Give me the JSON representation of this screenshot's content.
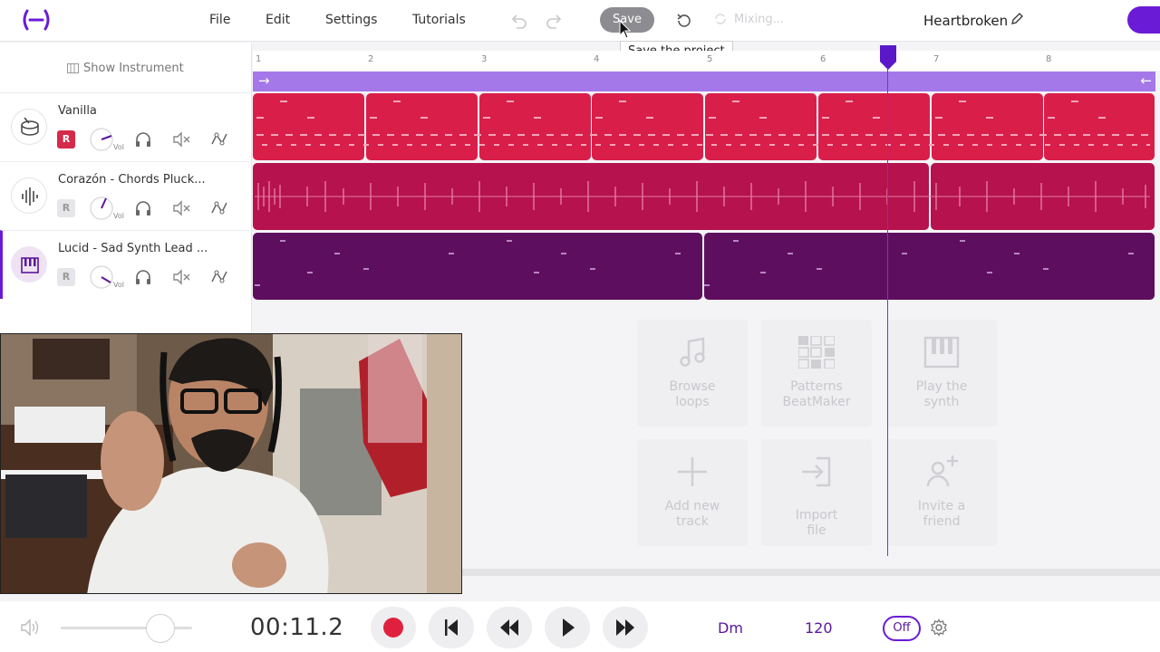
{
  "menu": {
    "file": "File",
    "edit": "Edit",
    "settings": "Settings",
    "tutorials": "Tutorials"
  },
  "toolbar": {
    "save_label": "Save",
    "save_tooltip": "Save the project",
    "mixing_label": "Mixing..."
  },
  "project": {
    "title": "Heartbroken"
  },
  "left_panel": {
    "show_instrument": "Show Instrument"
  },
  "tracks": [
    {
      "name": "Vanilla",
      "record": "R",
      "vol_label": "Vol",
      "icon": "drum-icon",
      "armed": true
    },
    {
      "name": "Corazón - Chords Pluck...",
      "record": "R",
      "vol_label": "Vol",
      "icon": "waveform-icon",
      "armed": false
    },
    {
      "name": "Lucid - Sad Synth Lead ...",
      "record": "R",
      "vol_label": "Vol",
      "icon": "keyboard-icon",
      "armed": false,
      "selected": true
    }
  ],
  "ruler": [
    "1",
    "2",
    "3",
    "4",
    "5",
    "6",
    "7",
    "8"
  ],
  "cards": [
    {
      "label": "Browse loops",
      "icon": "music-note-icon"
    },
    {
      "label": "Patterns BeatMaker",
      "icon": "grid-pads-icon"
    },
    {
      "label": "Play the synth",
      "icon": "piano-keys-icon"
    },
    {
      "label": "Add new track",
      "icon": "plus-icon"
    },
    {
      "label": "Import file",
      "icon": "import-icon"
    },
    {
      "label": "Invite a friend",
      "icon": "add-user-icon"
    }
  ],
  "transport": {
    "time": "00:11.2",
    "key": "Dm",
    "bpm": "120",
    "metronome": "Off"
  },
  "colors": {
    "accent": "#6a1bd6",
    "track1": "#d91e4a",
    "track2": "#b5124e",
    "track3": "#5e0e5f",
    "loop": "#a478e8",
    "record": "#e0213e"
  }
}
